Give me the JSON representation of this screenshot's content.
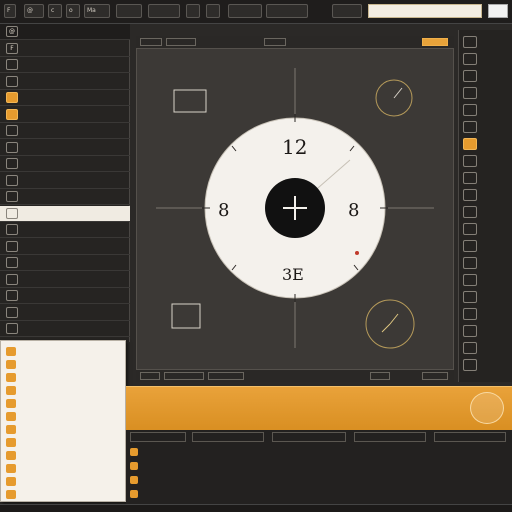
{
  "toolbar": {
    "buttons": [
      {
        "label": "F",
        "accent": false
      },
      {
        "label": "@",
        "accent": false
      },
      {
        "label": "c",
        "accent": false
      },
      {
        "label": "o",
        "accent": false
      },
      {
        "label": "Ma",
        "accent": false
      },
      {
        "label": "",
        "accent": false
      },
      {
        "label": "",
        "accent": false
      },
      {
        "label": "",
        "accent": false
      },
      {
        "label": "",
        "accent": false
      },
      {
        "label": "",
        "accent": false
      },
      {
        "label": "",
        "accent": false
      },
      {
        "label": "",
        "accent": true
      }
    ],
    "search_value": "",
    "colors": {
      "accent": "#e8a33a",
      "background": "#2b2927"
    }
  },
  "left_panel": {
    "rows": [
      {
        "icon": "@",
        "label": "",
        "orange": false
      },
      {
        "icon": "F",
        "label": "",
        "orange": false
      },
      {
        "icon": "",
        "label": "",
        "orange": false
      },
      {
        "icon": "",
        "label": "",
        "orange": false
      },
      {
        "icon": "",
        "label": "",
        "orange": true
      },
      {
        "icon": "",
        "label": "",
        "orange": true
      },
      {
        "icon": "",
        "label": "",
        "orange": false
      },
      {
        "icon": "",
        "label": "",
        "orange": false
      },
      {
        "icon": "",
        "label": "",
        "orange": false
      },
      {
        "icon": "",
        "label": "",
        "orange": false
      },
      {
        "icon": "",
        "label": "",
        "orange": false
      },
      {
        "icon": "",
        "label": "",
        "orange": false
      },
      {
        "icon": "",
        "label": "",
        "orange": false
      },
      {
        "icon": "",
        "label": "",
        "orange": false
      },
      {
        "icon": "",
        "label": "",
        "orange": false
      },
      {
        "icon": "",
        "label": "",
        "orange": false
      },
      {
        "icon": "",
        "label": "",
        "orange": false
      },
      {
        "icon": "",
        "label": "",
        "orange": false
      },
      {
        "icon": "",
        "label": "",
        "orange": false
      }
    ]
  },
  "popup_menu": {
    "items": [
      "",
      "",
      "",
      "",
      "",
      "",
      "",
      "",
      "",
      "",
      "",
      ""
    ]
  },
  "canvas": {
    "tabs_top": [
      "",
      "",
      "",
      ""
    ],
    "tabs_bottom": [
      "",
      "",
      "",
      "",
      ""
    ],
    "dial": {
      "top_label": "12",
      "left_label": "8",
      "right_label": "8",
      "bottom_label": "3E",
      "center_icon": "compass-star-icon"
    }
  },
  "right_panel": {
    "rows": [
      {
        "label": "",
        "orange": false
      },
      {
        "label": "",
        "orange": false
      },
      {
        "label": "",
        "orange": false
      },
      {
        "label": "",
        "orange": false
      },
      {
        "label": "",
        "orange": false
      },
      {
        "label": "",
        "orange": false
      },
      {
        "label": "",
        "orange": true
      },
      {
        "label": "",
        "orange": false
      },
      {
        "label": "",
        "orange": false
      },
      {
        "label": "",
        "orange": false
      },
      {
        "label": "",
        "orange": false
      },
      {
        "label": "",
        "orange": false
      },
      {
        "label": "",
        "orange": false
      },
      {
        "label": "",
        "orange": false
      },
      {
        "label": "",
        "orange": false
      },
      {
        "label": "",
        "orange": false
      },
      {
        "label": "",
        "orange": false
      },
      {
        "label": "",
        "orange": false
      },
      {
        "label": "",
        "orange": false
      },
      {
        "label": "",
        "orange": false
      }
    ]
  },
  "banner": {
    "title": "",
    "text": ""
  },
  "table": {
    "headers": [
      "",
      "",
      "",
      "",
      ""
    ],
    "rows": [
      [
        "",
        "",
        "",
        "",
        ""
      ],
      [
        "",
        "",
        "",
        "",
        ""
      ],
      [
        "",
        "",
        "",
        "",
        ""
      ],
      [
        "",
        "",
        "",
        "",
        ""
      ]
    ]
  },
  "status_bar": {
    "items": [
      "",
      "",
      "",
      ""
    ]
  }
}
